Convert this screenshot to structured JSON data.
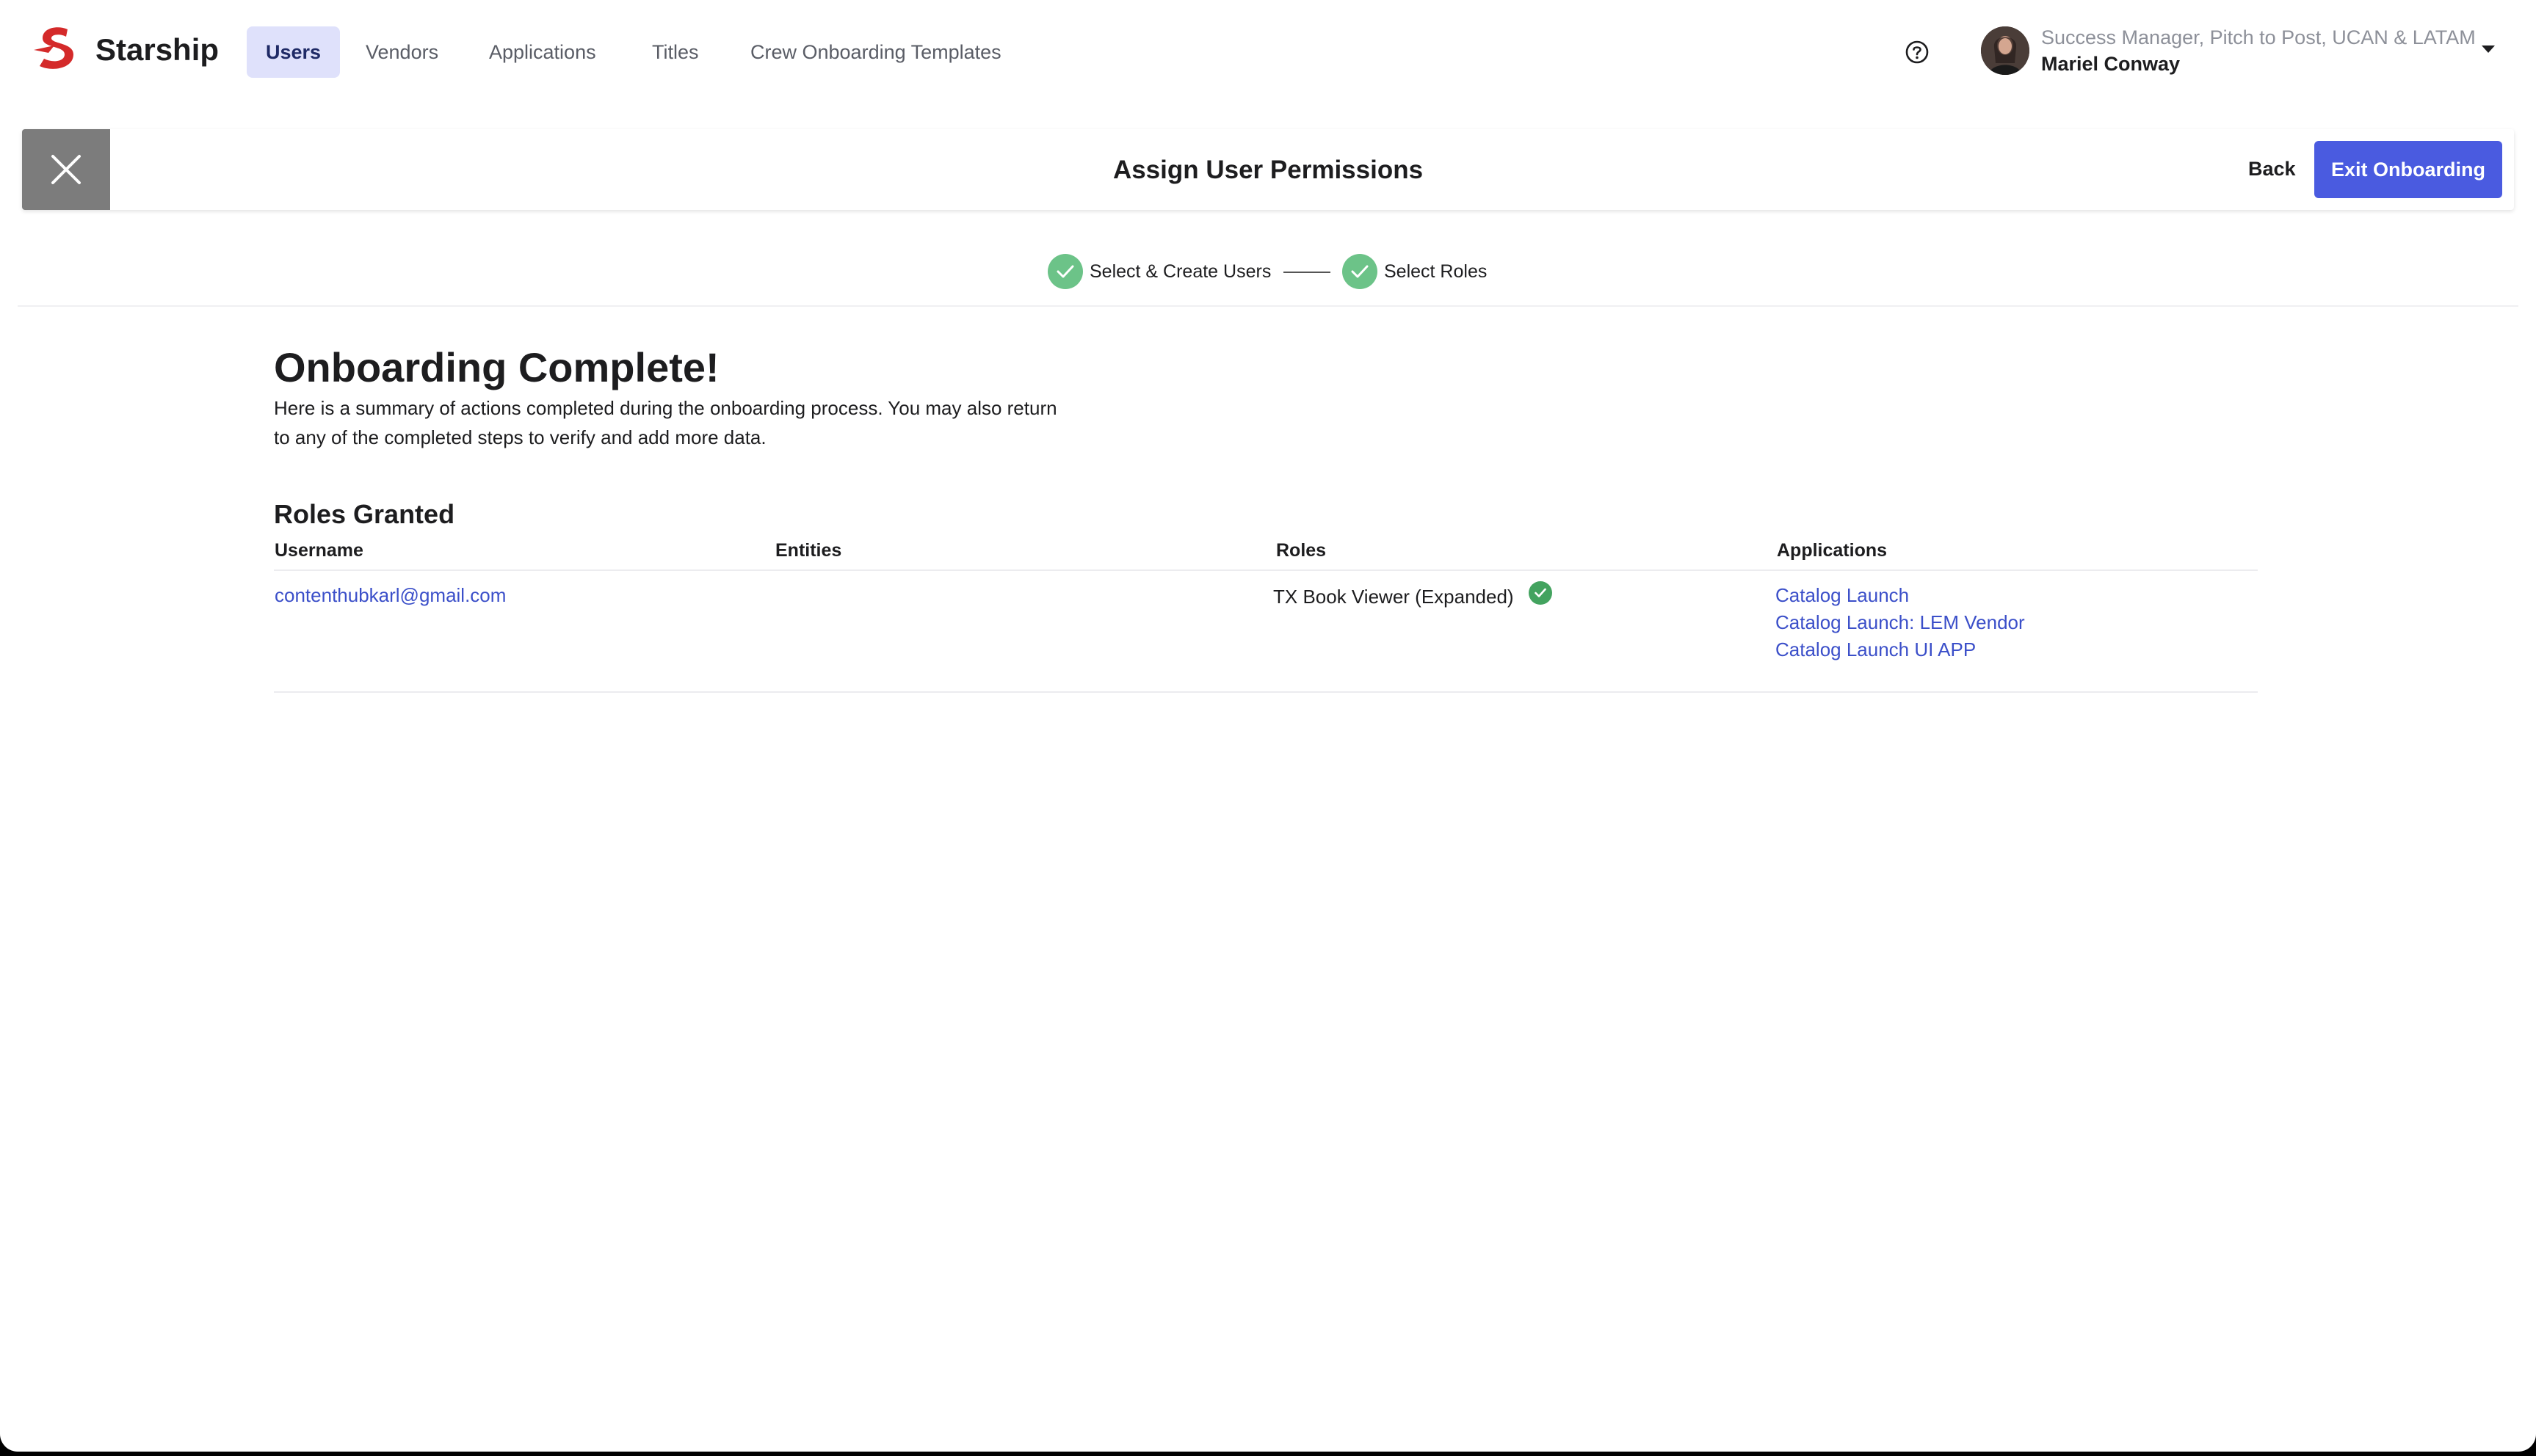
{
  "brand": {
    "name": "Starship",
    "logo_icon": "starship-logo-icon",
    "accent_color": "#d42a2a"
  },
  "nav": {
    "items": [
      {
        "label": "Users",
        "active": true
      },
      {
        "label": "Vendors",
        "active": false
      },
      {
        "label": "Applications",
        "active": false
      },
      {
        "label": "Titles",
        "active": false
      },
      {
        "label": "Crew Onboarding Templates",
        "active": false
      }
    ]
  },
  "user": {
    "role": "Success Manager, Pitch to Post, UCAN & LATAM",
    "name": "Mariel Conway",
    "help_icon": "question-circle-icon",
    "menu_icon": "caret-down-icon"
  },
  "header": {
    "title": "Assign User Permissions",
    "back_label": "Back",
    "exit_label": "Exit Onboarding",
    "exit_color": "#4a5be0",
    "close_icon": "close-icon"
  },
  "stepper": {
    "steps": [
      {
        "label": "Select & Create Users",
        "status": "complete"
      },
      {
        "label": "Select Roles",
        "status": "complete"
      }
    ],
    "complete_color": "#6cc388"
  },
  "summary": {
    "title": "Onboarding Complete!",
    "description": "Here is a summary of actions completed during the onboarding process. You may also return to any of the completed steps to verify and add more data."
  },
  "roles_granted": {
    "title": "Roles Granted",
    "columns": [
      "Username",
      "Entities",
      "Roles",
      "Applications"
    ],
    "rows": [
      {
        "username": "contenthubkarl@gmail.com",
        "entities": "",
        "role": "TX Book Viewer (Expanded)",
        "role_status": "granted",
        "applications": [
          "Catalog Launch",
          "Catalog Launch: LEM Vendor",
          "Catalog Launch UI APP"
        ]
      }
    ]
  }
}
